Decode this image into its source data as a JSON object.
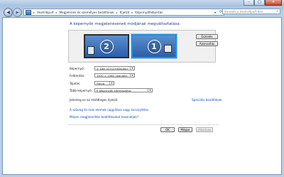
{
  "titlebar": {
    "min_glyph": "–",
    "max_glyph": "□",
    "close_glyph": "✕"
  },
  "nav": {
    "back_glyph": "◀",
    "forward_glyph": "▶",
    "breadcrumbs": [
      "Vezérlőpult",
      "Megjelenés és személyes beállítások",
      "Kijelző",
      "Képernyőfelbontás"
    ],
    "breadcrumb_separator": "▸",
    "dropdown_glyph": "▾",
    "refresh_glyph": "⟳",
    "search_placeholder": "Keresés a Vezérlőpult-ben",
    "search_icon_glyph": "⌕"
  },
  "main": {
    "title": "A képernyők megjelenésének módjának megváltoztatása",
    "monitors": [
      {
        "number": "2",
        "selected": false
      },
      {
        "number": "1",
        "selected": true
      }
    ],
    "detect_label": "Észlelés",
    "identify_label": "Azonosítás",
    "display_label": "Képernyő:",
    "display_value": "2. Dell U2311H(Digital)",
    "resolution_label": "Felbontás:",
    "resolution_value": "1920 × 1080 (ajánlott)",
    "orientation_label": "Tájolás:",
    "orientation_value": "Fekvő",
    "multiple_label": "Több képernyő:",
    "multiple_value": "E képernyők kiterjesztése",
    "primary_text": "Jelenleg ez az elsődleges kijelző.",
    "advanced_link": "Speciális beállítások",
    "link_text_size": "A szöveg és más elemek nagyítása vagy kicsinyítése",
    "link_settings": "Milyen megjelenítési beállításokat használjak?",
    "ok_label": "OK",
    "cancel_label": "Mégse",
    "apply_label": "Alkalmaz"
  },
  "colors": {
    "accent": "#1e3f8a",
    "link": "#0a47b4",
    "monitor_fill": "#2b5ea8"
  }
}
